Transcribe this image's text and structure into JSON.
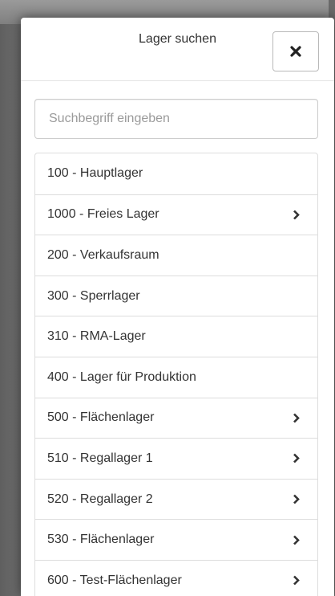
{
  "modal": {
    "title": "Lager suchen",
    "close_icon": "close-icon"
  },
  "search": {
    "placeholder": "Suchbegriff eingeben",
    "value": ""
  },
  "items": [
    {
      "label": "100 - Hauptlager",
      "has_children": false
    },
    {
      "label": "1000 - Freies Lager",
      "has_children": true
    },
    {
      "label": "200 - Verkaufsraum",
      "has_children": false
    },
    {
      "label": "300 - Sperrlager",
      "has_children": false
    },
    {
      "label": "310 - RMA-Lager",
      "has_children": false
    },
    {
      "label": "400 - Lager für Produktion",
      "has_children": false
    },
    {
      "label": "500 - Flächenlager",
      "has_children": true
    },
    {
      "label": "510 - Regallager 1",
      "has_children": true
    },
    {
      "label": "520 - Regallager 2",
      "has_children": true
    },
    {
      "label": "530 - Flächenlager",
      "has_children": true
    },
    {
      "label": "600 - Test-Flächenlager",
      "has_children": true
    }
  ]
}
